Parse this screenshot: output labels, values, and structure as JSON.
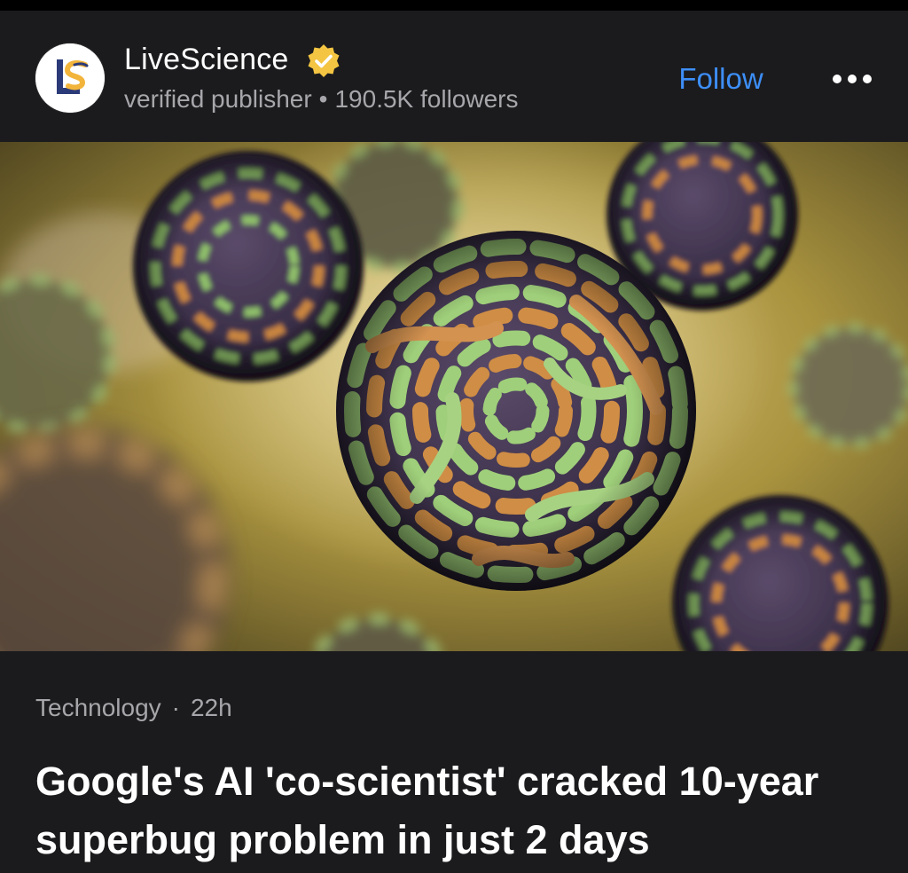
{
  "post": {
    "publisher": {
      "name": "LiveScience",
      "subtitle": "verified publisher",
      "separator": "•",
      "followers": "190.5K followers",
      "logo_initials": "LS",
      "verified_icon": "verified-badge-icon",
      "accent_color": "#f4c542"
    },
    "follow_label": "Follow",
    "follow_color": "#3d8ef7",
    "more_icon": "more-horizontal-icon",
    "image": {
      "subject": "virus-particles-illustration"
    },
    "category": "Technology",
    "meta_separator": "·",
    "age": "22h",
    "headline": "Google's AI 'co-scientist' cracked 10-year superbug problem in just 2 days"
  }
}
